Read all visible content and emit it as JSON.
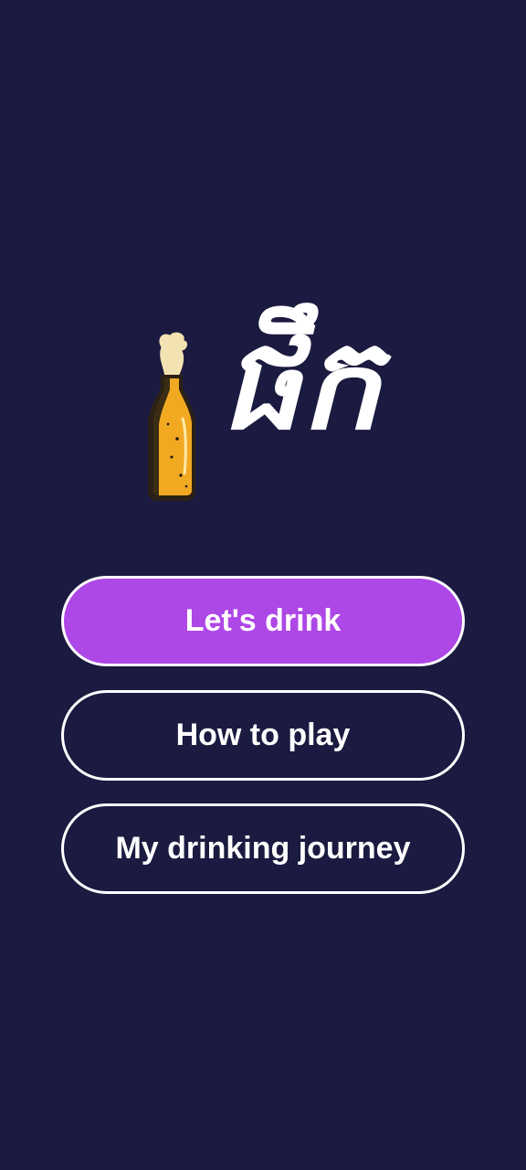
{
  "app": {
    "logo_text": "ផឹក"
  },
  "menu": {
    "primary_label": "Let's drink",
    "how_to_play_label": "How to play",
    "journey_label": "My drinking journey"
  },
  "colors": {
    "background": "#1b1a40",
    "primary_button": "#ad47e6",
    "button_border": "#ffffff",
    "text": "#ffffff",
    "beer": "#f2a922"
  },
  "icons": {
    "logo_icon": "beer-bottle-icon"
  }
}
